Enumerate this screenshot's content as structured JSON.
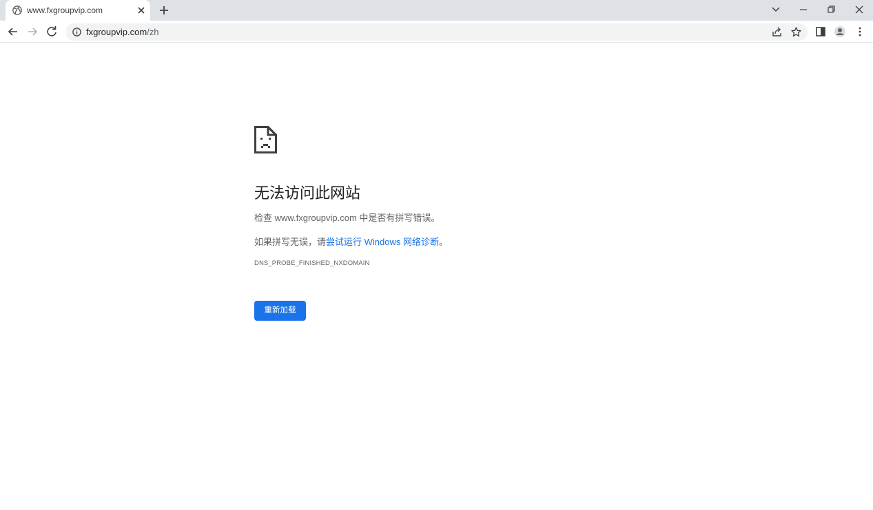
{
  "browser": {
    "tab": {
      "title": "www.fxgroupvip.com",
      "favicon": "globe-icon",
      "close_icon": "close-icon"
    },
    "new_tab_icon": "plus-icon",
    "window_controls": [
      "chevron-down-icon",
      "minimize-icon",
      "restore-icon",
      "close-icon"
    ],
    "toolbar": {
      "back_icon": "arrow-left-icon",
      "forward_icon": "arrow-right-icon",
      "reload_icon": "reload-icon",
      "site_info_icon": "info-icon",
      "url_host": "fxgroupvip.com",
      "url_path": "/zh",
      "share_icon": "share-icon",
      "bookmark_icon": "star-icon",
      "side_panel_icon": "side-panel-icon",
      "profile_icon": "profile-icon",
      "menu_icon": "more-vert-icon"
    }
  },
  "error_page": {
    "icon": "sad-page-icon",
    "title": "无法访问此网站",
    "check_line": "检查 www.fxgroupvip.com 中是否有拼写错误。",
    "hint_prefix": "如果拼写无误，请",
    "hint_link": "尝试运行 Windows 网络诊断",
    "hint_suffix": "。",
    "error_code": "DNS_PROBE_FINISHED_NXDOMAIN",
    "reload_label": "重新加载"
  },
  "colors": {
    "tabstrip_bg": "#dee1e6",
    "omnibox_bg": "#f1f3f4",
    "link": "#1a73e8",
    "button_bg": "#1a73e8",
    "text_secondary": "#5f6368"
  }
}
